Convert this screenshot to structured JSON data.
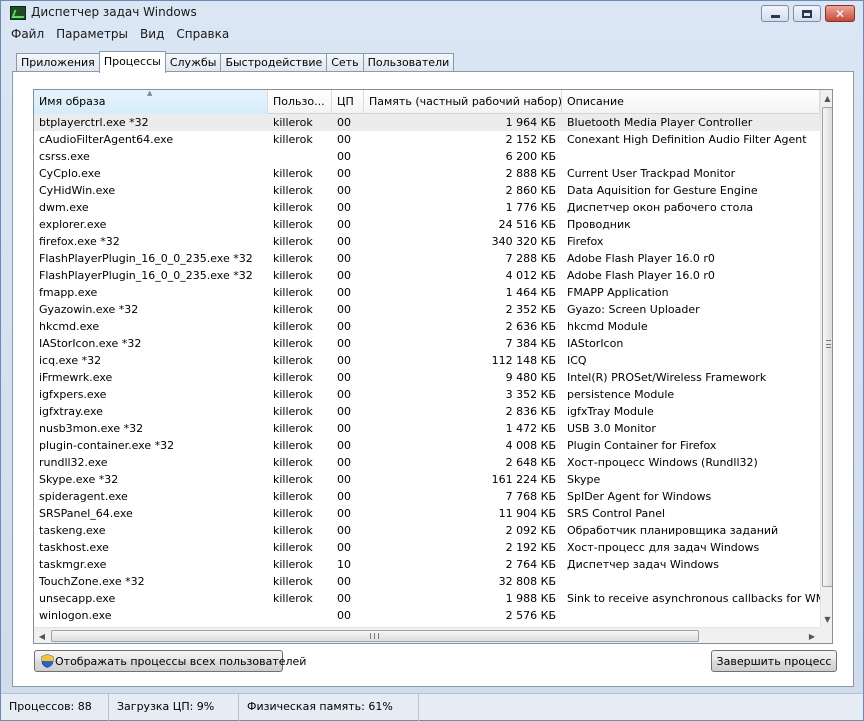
{
  "window": {
    "title": "Диспетчер задач Windows"
  },
  "menu": [
    "Файл",
    "Параметры",
    "Вид",
    "Справка"
  ],
  "tabs": [
    "Приложения",
    "Процессы",
    "Службы",
    "Быстродействие",
    "Сеть",
    "Пользователи"
  ],
  "active_tab": "Процессы",
  "columns": {
    "name": "Имя образа",
    "user": "Пользо...",
    "cpu": "ЦП",
    "memory": "Память (частный рабочий набор)",
    "description": "Описание"
  },
  "processes": [
    [
      "btplayerctrl.exe *32",
      "killerok",
      "00",
      "1 964 КБ",
      "Bluetooth Media Player Controller"
    ],
    [
      "cAudioFilterAgent64.exe",
      "killerok",
      "00",
      "2 152 КБ",
      "Conexant High Definition Audio Filter Agent"
    ],
    [
      "csrss.exe",
      "",
      "00",
      "6 200 КБ",
      ""
    ],
    [
      "CyCpIo.exe",
      "killerok",
      "00",
      "2 888 КБ",
      "Current User Trackpad Monitor"
    ],
    [
      "CyHidWin.exe",
      "killerok",
      "00",
      "2 860 КБ",
      "Data Aquisition for Gesture Engine"
    ],
    [
      "dwm.exe",
      "killerok",
      "00",
      "1 776 КБ",
      "Диспетчер окон рабочего стола"
    ],
    [
      "explorer.exe",
      "killerok",
      "00",
      "24 516 КБ",
      "Проводник"
    ],
    [
      "firefox.exe *32",
      "killerok",
      "00",
      "340 320 КБ",
      "Firefox"
    ],
    [
      "FlashPlayerPlugin_16_0_0_235.exe *32",
      "killerok",
      "00",
      "7 288 КБ",
      "Adobe Flash Player 16.0 r0"
    ],
    [
      "FlashPlayerPlugin_16_0_0_235.exe *32",
      "killerok",
      "00",
      "4 012 КБ",
      "Adobe Flash Player 16.0 r0"
    ],
    [
      "fmapp.exe",
      "killerok",
      "00",
      "1 464 КБ",
      "FMAPP Application"
    ],
    [
      "Gyazowin.exe *32",
      "killerok",
      "00",
      "2 352 КБ",
      "Gyazo: Screen Uploader"
    ],
    [
      "hkcmd.exe",
      "killerok",
      "00",
      "2 636 КБ",
      "hkcmd Module"
    ],
    [
      "IAStorIcon.exe *32",
      "killerok",
      "00",
      "7 384 КБ",
      "IAStorIcon"
    ],
    [
      "icq.exe *32",
      "killerok",
      "00",
      "112 148 КБ",
      "ICQ"
    ],
    [
      "iFrmewrk.exe",
      "killerok",
      "00",
      "9 480 КБ",
      "Intel(R) PROSet/Wireless Framework"
    ],
    [
      "igfxpers.exe",
      "killerok",
      "00",
      "3 352 КБ",
      "persistence Module"
    ],
    [
      "igfxtray.exe",
      "killerok",
      "00",
      "2 836 КБ",
      "igfxTray Module"
    ],
    [
      "nusb3mon.exe *32",
      "killerok",
      "00",
      "1 472 КБ",
      "USB 3.0 Monitor"
    ],
    [
      "plugin-container.exe *32",
      "killerok",
      "00",
      "4 008 КБ",
      "Plugin Container for Firefox"
    ],
    [
      "rundll32.exe",
      "killerok",
      "00",
      "2 648 КБ",
      "Хост-процесс Windows (Rundll32)"
    ],
    [
      "Skype.exe *32",
      "killerok",
      "00",
      "161 224 КБ",
      "Skype"
    ],
    [
      "spideragent.exe",
      "killerok",
      "00",
      "7 768 КБ",
      "SpIDer Agent for Windows"
    ],
    [
      "SRSPanel_64.exe",
      "killerok",
      "00",
      "11 904 КБ",
      "SRS Control Panel"
    ],
    [
      "taskeng.exe",
      "killerok",
      "00",
      "2 092 КБ",
      "Обработчик планировщика заданий"
    ],
    [
      "taskhost.exe",
      "killerok",
      "00",
      "2 192 КБ",
      "Хост-процесс для задач Windows"
    ],
    [
      "taskmgr.exe",
      "killerok",
      "10",
      "2 764 КБ",
      "Диспетчер задач Windows"
    ],
    [
      "TouchZone.exe *32",
      "killerok",
      "00",
      "32 808 КБ",
      ""
    ],
    [
      "unsecapp.exe",
      "killerok",
      "00",
      "1 988 КБ",
      "Sink to receive asynchronous callbacks for WMI client"
    ],
    [
      "winlogon.exe",
      "",
      "00",
      "2 576 КБ",
      ""
    ]
  ],
  "buttons": {
    "show_all": "Отображать процессы всех пользователей",
    "end_process": "Завершить процесс"
  },
  "status": {
    "processes": "Процессов: 88",
    "cpu": "Загрузка ЦП: 9%",
    "memory": "Физическая память: 61%"
  },
  "icons": {
    "app": "task-manager-icon",
    "shield": "uac-shield-icon"
  }
}
